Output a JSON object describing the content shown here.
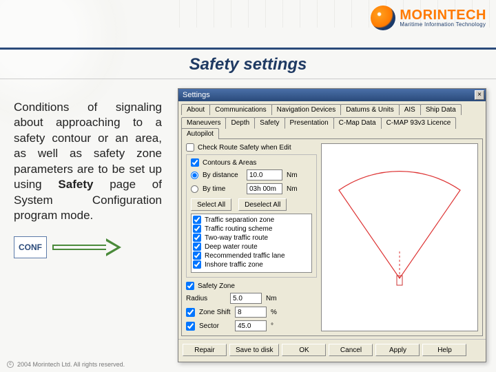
{
  "brand": {
    "name_left": "M",
    "name_mid": "O",
    "name_rest": "RINTECH",
    "tagline": "Maritime Information Technology"
  },
  "page_title": "Safety settings",
  "description_pre": "Conditions of signaling about approaching to a safety contour or an area, as well as safety zone parameters are to be set up using ",
  "description_bold": "Safety",
  "description_post": " page of System Configuration program mode.",
  "conf_label": "CONF",
  "window": {
    "caption": "Settings",
    "tabs_row1": [
      "About",
      "Communications",
      "Navigation Devices",
      "Datums & Units",
      "AIS",
      "Ship Data"
    ],
    "tabs_row2": [
      "Maneuvers",
      "Depth",
      "Safety",
      "Presentation",
      "C-Map Data",
      "C-MAP 93v3 Licence",
      "Autopilot"
    ],
    "active_tab": "Safety",
    "check_route": "Check Route Safety when Edit",
    "group_label": "Contours & Areas",
    "by_distance": "By distance",
    "by_time": "By time",
    "distance_value": "10.0",
    "distance_unit": "Nm",
    "time_value": "03h 00m",
    "time_unit": "Nm",
    "select_all": "Select All",
    "deselect_all": "Deselect All",
    "zones": [
      "Traffic separation zone",
      "Traffic routing scheme",
      "Two-way traffic route",
      "Deep water route",
      "Recommended traffic lane",
      "Inshore traffic zone"
    ],
    "safety_zone": "Safety Zone",
    "radius_label": "Radius",
    "radius_value": "5.0",
    "radius_unit": "Nm",
    "zoneshift_label": "Zone Shift",
    "zoneshift_value": "8",
    "zoneshift_unit": "%",
    "sector_label": "Sector",
    "sector_value": "45.0",
    "sector_unit": "°",
    "buttons": [
      "Repair",
      "Save to disk",
      "OK",
      "Cancel",
      "Apply",
      "Help"
    ]
  },
  "footer": "2004 Morintech Ltd. All rights reserved."
}
